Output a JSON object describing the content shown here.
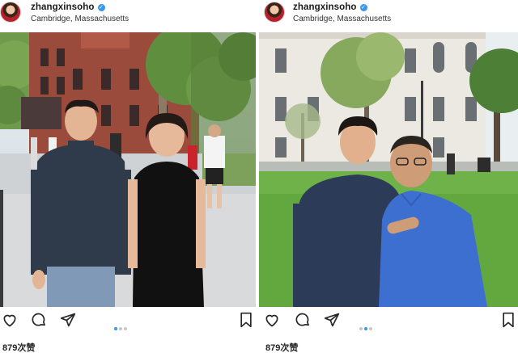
{
  "posts": [
    {
      "username": "zhangxinsoho",
      "location": "Cambridge, Massachusetts",
      "likes": "879次赞",
      "carousel": {
        "count": 3,
        "active_index": 0
      }
    },
    {
      "username": "zhangxinsoho",
      "location": "Cambridge, Massachusetts",
      "likes": "879次赞",
      "carousel": {
        "count": 3,
        "active_index": 1
      }
    }
  ],
  "icons": [
    "heart-icon",
    "comment-icon",
    "share-icon",
    "bookmark-icon",
    "verified-badge-icon"
  ],
  "colors": {
    "verified": "#3897f0",
    "dot_active": "#3897f0",
    "dot_inactive": "#c7c7c7",
    "text": "#262626"
  }
}
